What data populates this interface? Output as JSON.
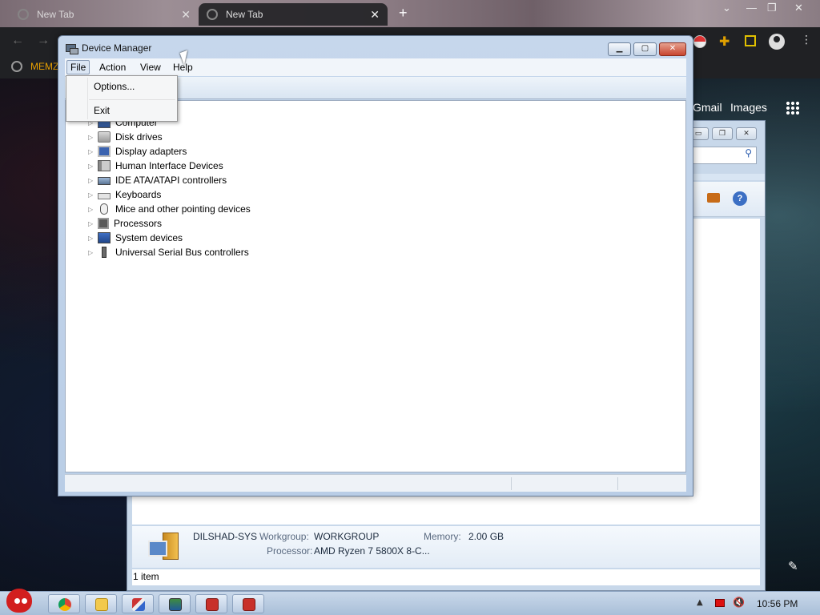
{
  "browser": {
    "tabs": [
      {
        "label": "New Tab"
      },
      {
        "label": "New Tab"
      }
    ],
    "bookmark_label": "MEMZ",
    "links": {
      "gmail": "Gmail",
      "images": "Images"
    }
  },
  "explorer": {
    "computer_name": "DILSHAD-SYS",
    "workgroup_label": "Workgroup:",
    "workgroup_value": "WORKGROUP",
    "memory_label": "Memory:",
    "memory_value": "2.00 GB",
    "processor_label": "Processor:",
    "processor_value": "AMD Ryzen 7 5800X 8-C...",
    "status": "1 item"
  },
  "device_manager": {
    "title": "Device Manager",
    "menus": [
      "File",
      "Action",
      "View",
      "Help"
    ],
    "file_menu": [
      "Options...",
      "Exit"
    ],
    "tree": [
      {
        "label": "Computer",
        "icon": "computer-icon"
      },
      {
        "label": "Disk drives",
        "icon": "disk-drive-icon"
      },
      {
        "label": "Display adapters",
        "icon": "display-adapter-icon"
      },
      {
        "label": "Human Interface Devices",
        "icon": "hid-icon"
      },
      {
        "label": "IDE ATA/ATAPI controllers",
        "icon": "ide-controller-icon"
      },
      {
        "label": "Keyboards",
        "icon": "keyboard-icon"
      },
      {
        "label": "Mice and other pointing devices",
        "icon": "mouse-icon"
      },
      {
        "label": "Processors",
        "icon": "processor-icon"
      },
      {
        "label": "System devices",
        "icon": "system-device-icon"
      },
      {
        "label": "Universal Serial Bus controllers",
        "icon": "usb-controller-icon"
      }
    ]
  },
  "taskbar": {
    "clock": "10:56 PM"
  }
}
